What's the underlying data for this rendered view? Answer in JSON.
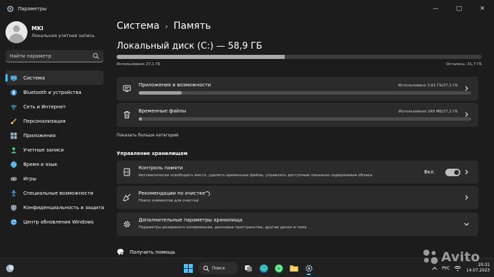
{
  "window": {
    "title": "Параметры",
    "controls": {
      "minimize": "—",
      "maximize": "□",
      "close": "✕"
    }
  },
  "user": {
    "name": "MKI",
    "account_type": "Локальная учетная запись"
  },
  "search": {
    "placeholder": "Найти параметр"
  },
  "sidebar": {
    "items": [
      {
        "label": "Система",
        "icon": "system-icon",
        "active": true
      },
      {
        "label": "Bluetooth и устройства",
        "icon": "bluetooth-icon"
      },
      {
        "label": "Сеть и Интернет",
        "icon": "wifi-icon"
      },
      {
        "label": "Персонализация",
        "icon": "brush-icon"
      },
      {
        "label": "Приложения",
        "icon": "apps-icon"
      },
      {
        "label": "Учетные записи",
        "icon": "user-icon"
      },
      {
        "label": "Время и язык",
        "icon": "globe-clock-icon"
      },
      {
        "label": "Игры",
        "icon": "gamepad-icon"
      },
      {
        "label": "Специальные возможности",
        "icon": "accessibility-icon"
      },
      {
        "label": "Конфиденциальность и защита",
        "icon": "shield-icon"
      },
      {
        "label": "Центр обновления Windows",
        "icon": "update-icon"
      }
    ]
  },
  "main": {
    "breadcrumb": {
      "parent": "Система",
      "separator": "›",
      "current": "Память"
    },
    "disk": {
      "title": "Локальный диск (C:) — 58,9 ГБ",
      "used_label": "Использовано 27,1 ГБ",
      "free_label": "Осталось: 31,7 ГБ",
      "used_fraction": 0.46
    },
    "categories": [
      {
        "title": "Приложения и возможности",
        "usage": "Использовано 3,61 ГБ/27,1 ГБ",
        "fraction": 0.13,
        "icon": "apps-features-icon"
      },
      {
        "title": "Временные файлы",
        "usage": "Использовано 249 МБ/27,1 ГБ",
        "fraction": 0.01,
        "icon": "trash-icon"
      }
    ],
    "show_more": "Показать больше категорий",
    "management": {
      "section_title": "Управление хранилищем",
      "items": [
        {
          "title": "Контроль памяти",
          "subtitle": "Автоматически освободить место, удалить временные файлы, управлять доступным локально содержимым облака",
          "toggle_label": "Вкл.",
          "toggle_on": true,
          "icon": "storage-sense-icon"
        },
        {
          "title": "Рекомендации по очистке",
          "subtitle": "Поиск элементов для очистки",
          "icon": "broom-icon"
        },
        {
          "title": "Дополнительные параметры хранилища",
          "subtitle": "Параметры резервного копирования, дисковые пространства, другие диски и тома",
          "icon": "gear-icon"
        }
      ]
    },
    "help": {
      "label": "Получить помощь"
    }
  },
  "taskbar": {
    "search_label": "Поиск",
    "language": "РУС",
    "time": "20:31",
    "date": "14.07.2023"
  },
  "watermark": {
    "text": "Avito"
  },
  "colors": {
    "accent": "#4cc2ff",
    "background": "#1c1c1c",
    "card": "#2b2b2b"
  }
}
